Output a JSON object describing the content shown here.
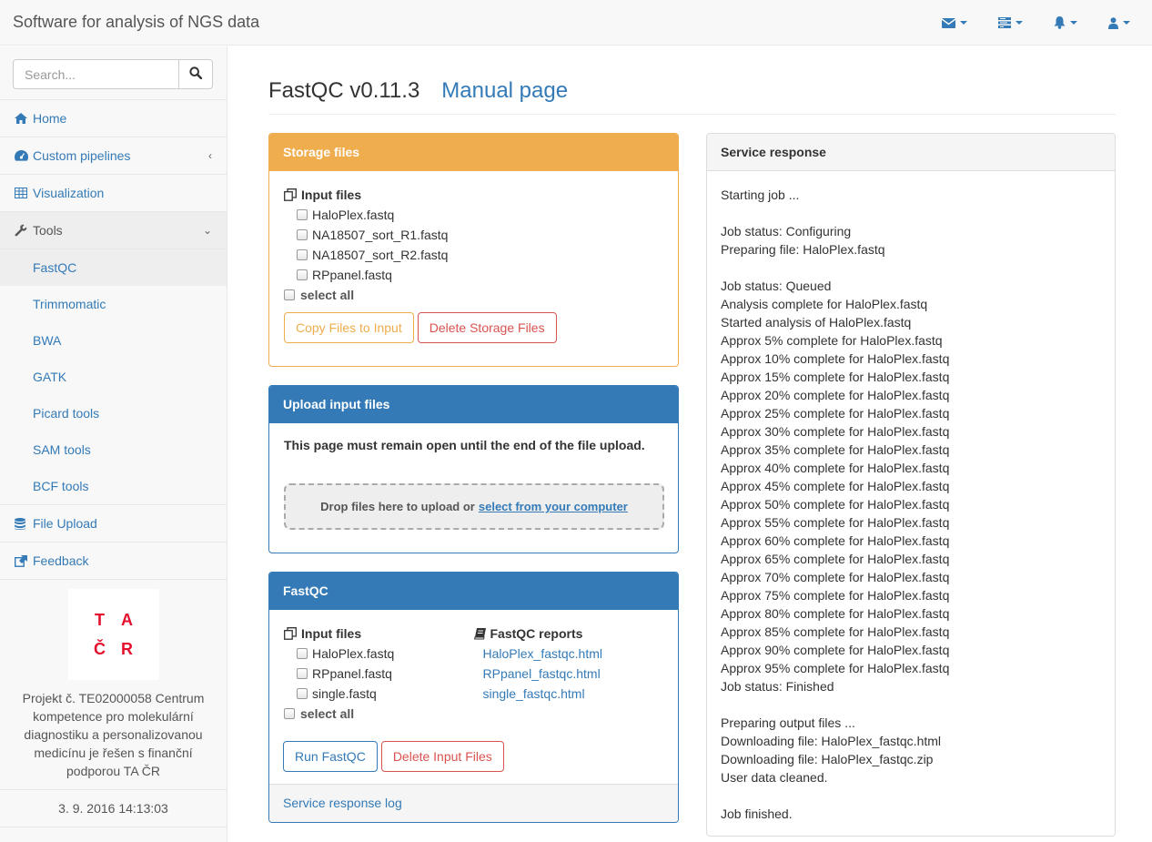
{
  "navbar": {
    "brand": "Software for analysis of NGS data",
    "icons": [
      "envelope-icon",
      "tasks-icon",
      "bell-icon",
      "user-icon"
    ]
  },
  "sidebar": {
    "search": {
      "placeholder": "Search..."
    },
    "menu": [
      {
        "label": "Home",
        "icon": "home-icon"
      },
      {
        "label": "Custom pipelines",
        "icon": "dashboard-icon"
      },
      {
        "label": "Visualization",
        "icon": "table-icon"
      },
      {
        "label": "Tools",
        "icon": "wrench-icon"
      }
    ],
    "tools_submenu": [
      "FastQC",
      "Trimmomatic",
      "BWA",
      "GATK",
      "Picard tools",
      "SAM tools",
      "BCF tools"
    ],
    "menu_bottom": [
      {
        "label": "File Upload",
        "icon": "database-icon"
      },
      {
        "label": "Feedback",
        "icon": "external-link-icon"
      }
    ],
    "logo_letters": [
      "T",
      "A",
      "Č",
      "R"
    ],
    "project_text": "Projekt č. TE02000058 Centrum kompetence pro molekulární diagnostiku a personalizovanou medicínu je řešen s finanční podporou TA ČR",
    "datetime": "3. 9. 2016 14:13:03"
  },
  "header": {
    "title": "FastQC v0.11.3",
    "manual_link": "Manual page"
  },
  "storage_panel": {
    "title": "Storage files",
    "list_title": "Input files",
    "files": [
      "HaloPlex.fastq",
      "NA18507_sort_R1.fastq",
      "NA18507_sort_R2.fastq",
      "RPpanel.fastq"
    ],
    "select_all": "select all",
    "copy_button": "Copy Files to Input",
    "delete_button": "Delete Storage Files"
  },
  "upload_panel": {
    "title": "Upload input files",
    "warning": "This page must remain open until the end of the file upload.",
    "drop_text": "Drop files here to upload or",
    "drop_link": "select from your computer"
  },
  "fastqc_panel": {
    "title": "FastQC",
    "input_title": "Input files",
    "input_files": [
      "HaloPlex.fastq",
      "RPpanel.fastq",
      "single.fastq"
    ],
    "select_all": "select all",
    "reports_title": "FastQC reports",
    "reports": [
      "HaloPlex_fastqc.html",
      "RPpanel_fastqc.html",
      "single_fastqc.html"
    ],
    "run_button": "Run FastQC",
    "delete_button": "Delete Input Files",
    "footer_link": "Service response log"
  },
  "response_panel": {
    "title": "Service response",
    "lines": [
      "Starting job ...",
      "",
      "Job status: Configuring",
      "Preparing file: HaloPlex.fastq",
      "",
      "Job status: Queued",
      "Analysis complete for HaloPlex.fastq",
      "Started analysis of HaloPlex.fastq",
      "Approx 5% complete for HaloPlex.fastq",
      "Approx 10% complete for HaloPlex.fastq",
      "Approx 15% complete for HaloPlex.fastq",
      "Approx 20% complete for HaloPlex.fastq",
      "Approx 25% complete for HaloPlex.fastq",
      "Approx 30% complete for HaloPlex.fastq",
      "Approx 35% complete for HaloPlex.fastq",
      "Approx 40% complete for HaloPlex.fastq",
      "Approx 45% complete for HaloPlex.fastq",
      "Approx 50% complete for HaloPlex.fastq",
      "Approx 55% complete for HaloPlex.fastq",
      "Approx 60% complete for HaloPlex.fastq",
      "Approx 65% complete for HaloPlex.fastq",
      "Approx 70% complete for HaloPlex.fastq",
      "Approx 75% complete for HaloPlex.fastq",
      "Approx 80% complete for HaloPlex.fastq",
      "Approx 85% complete for HaloPlex.fastq",
      "Approx 90% complete for HaloPlex.fastq",
      "Approx 95% complete for HaloPlex.fastq",
      "Job status: Finished",
      "",
      "Preparing output files ...",
      "Downloading file: HaloPlex_fastqc.html",
      "Downloading file: HaloPlex_fastqc.zip",
      "User data cleaned.",
      "",
      "Job finished."
    ]
  },
  "colors": {
    "primary": "#337ab7",
    "warning": "#f0ad4e",
    "danger": "#d9534f",
    "logo_red": "#e30f2d"
  }
}
